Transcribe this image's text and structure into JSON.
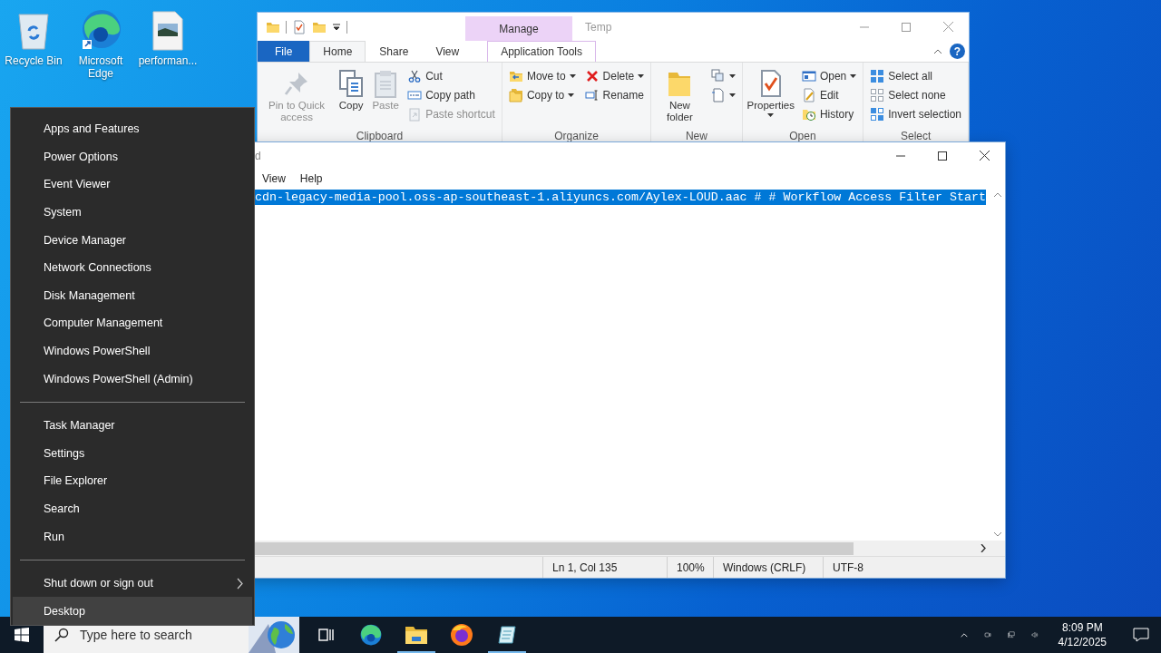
{
  "desktop": {
    "icons": [
      {
        "label": "Recycle Bin",
        "kind": "bin"
      },
      {
        "label": "Microsoft Edge",
        "kind": "edge"
      },
      {
        "label": "performan...",
        "kind": "image"
      }
    ]
  },
  "explorer": {
    "title": "Temp",
    "context_group": "Manage",
    "help_label": "?",
    "tabs": [
      {
        "label": "File",
        "kind": "file",
        "selected": false
      },
      {
        "label": "Home",
        "kind": "tab",
        "selected": true
      },
      {
        "label": "Share",
        "kind": "tab",
        "selected": false
      },
      {
        "label": "View",
        "kind": "tab",
        "selected": false
      },
      {
        "label": "Application Tools",
        "kind": "context",
        "selected": false
      }
    ],
    "groups": [
      {
        "label": "Clipboard",
        "columns": [
          [
            {
              "label": "Pin to Quick access",
              "kind": "large",
              "disabled": true,
              "dropdown": false
            }
          ],
          [
            {
              "label": "Copy",
              "kind": "large",
              "disabled": false,
              "dropdown": false
            }
          ],
          [
            {
              "label": "Paste",
              "kind": "large",
              "disabled": true,
              "dropdown": false
            }
          ],
          [
            {
              "label": "Cut",
              "kind": "small",
              "disabled": false,
              "dropdown": false
            },
            {
              "label": "Copy path",
              "kind": "small",
              "disabled": false,
              "dropdown": false
            },
            {
              "label": "Paste shortcut",
              "kind": "small",
              "disabled": true,
              "dropdown": false
            }
          ]
        ]
      },
      {
        "label": "Organize",
        "columns": [
          [
            {
              "label": "Move to",
              "kind": "small",
              "disabled": false,
              "dropdown": true
            },
            {
              "label": "Copy to",
              "kind": "small",
              "disabled": false,
              "dropdown": true
            }
          ],
          [
            {
              "label": "Delete",
              "kind": "small",
              "disabled": false,
              "dropdown": true
            },
            {
              "label": "Rename",
              "kind": "small",
              "disabled": false,
              "dropdown": false
            }
          ]
        ]
      },
      {
        "label": "New",
        "columns": [
          [
            {
              "label": "New folder",
              "kind": "large",
              "disabled": false,
              "dropdown": false
            }
          ],
          [
            {
              "kind": "small",
              "disabled": false,
              "dropdown": true
            },
            {
              "kind": "small",
              "disabled": false,
              "dropdown": true
            }
          ]
        ]
      },
      {
        "label": "Open",
        "columns": [
          [
            {
              "label": "Properties",
              "kind": "large",
              "disabled": false,
              "dropdown": true
            }
          ],
          [
            {
              "label": "Open",
              "kind": "small",
              "disabled": false,
              "dropdown": true
            },
            {
              "label": "Edit",
              "kind": "small",
              "disabled": false,
              "dropdown": false
            },
            {
              "label": "History",
              "kind": "small",
              "disabled": false,
              "dropdown": false
            }
          ]
        ]
      },
      {
        "label": "Select",
        "columns": [
          [
            {
              "label": "Select all",
              "kind": "small",
              "disabled": false,
              "dropdown": false
            },
            {
              "label": "Select none",
              "kind": "small",
              "disabled": false,
              "dropdown": false
            },
            {
              "label": "Invert selection",
              "kind": "small",
              "disabled": false,
              "dropdown": false
            }
          ]
        ]
      }
    ]
  },
  "notepad": {
    "title": "d",
    "menu": [
      "View",
      "Help"
    ],
    "text": "cdn-legacy-media-pool.oss-ap-southeast-1.aliyuncs.com/Aylex-LOUD.aac # # Workflow Access Filter Start",
    "text_selected": true,
    "status": [
      "Ln 1, Col 135",
      "100%",
      "Windows (CRLF)",
      "UTF-8"
    ]
  },
  "power_menu": {
    "sections": [
      {
        "items": [
          {
            "label": "Apps and Features",
            "selected": false,
            "submenu": false
          },
          {
            "label": "Power Options",
            "selected": false,
            "submenu": false
          },
          {
            "label": "Event Viewer",
            "selected": false,
            "submenu": false
          },
          {
            "label": "System",
            "selected": false,
            "submenu": false
          },
          {
            "label": "Device Manager",
            "selected": false,
            "submenu": false
          },
          {
            "label": "Network Connections",
            "selected": false,
            "submenu": false
          },
          {
            "label": "Disk Management",
            "selected": false,
            "submenu": false
          },
          {
            "label": "Computer Management",
            "selected": false,
            "submenu": false
          },
          {
            "label": "Windows PowerShell",
            "selected": false,
            "submenu": false
          },
          {
            "label": "Windows PowerShell (Admin)",
            "selected": false,
            "submenu": false
          }
        ]
      },
      {
        "items": [
          {
            "label": "Task Manager",
            "selected": false,
            "submenu": false
          },
          {
            "label": "Settings",
            "selected": false,
            "submenu": false
          },
          {
            "label": "File Explorer",
            "selected": false,
            "submenu": false
          },
          {
            "label": "Search",
            "selected": false,
            "submenu": false
          },
          {
            "label": "Run",
            "selected": false,
            "submenu": false
          }
        ]
      },
      {
        "items": [
          {
            "label": "Shut down or sign out",
            "selected": false,
            "submenu": true
          },
          {
            "label": "Desktop",
            "selected": true,
            "submenu": false
          }
        ]
      }
    ]
  },
  "taskbar": {
    "search": {
      "placeholder": "Type here to search"
    },
    "apps": [
      {
        "kind": "task-view",
        "active": false
      },
      {
        "kind": "edge",
        "active": false
      },
      {
        "kind": "explorer",
        "active": true
      },
      {
        "kind": "firefox",
        "active": false
      },
      {
        "kind": "notepad",
        "active": true
      }
    ],
    "time": "8:09 PM",
    "date": "4/12/2025"
  }
}
